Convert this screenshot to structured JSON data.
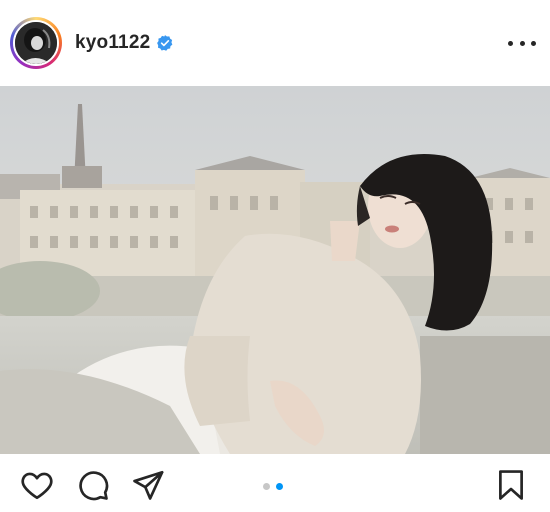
{
  "post": {
    "username": "kyo1122",
    "verified": true,
    "more_icon": "more-horizontal-icon"
  },
  "carousel": {
    "total": 2,
    "active_index": 2
  },
  "actions": {
    "like_icon": "heart-icon",
    "comment_icon": "comment-icon",
    "share_icon": "send-icon",
    "save_icon": "bookmark-icon"
  },
  "colors": {
    "accent": "#0095f6",
    "verified": "#3897f0",
    "inactive_dot": "#c7c7c7"
  }
}
